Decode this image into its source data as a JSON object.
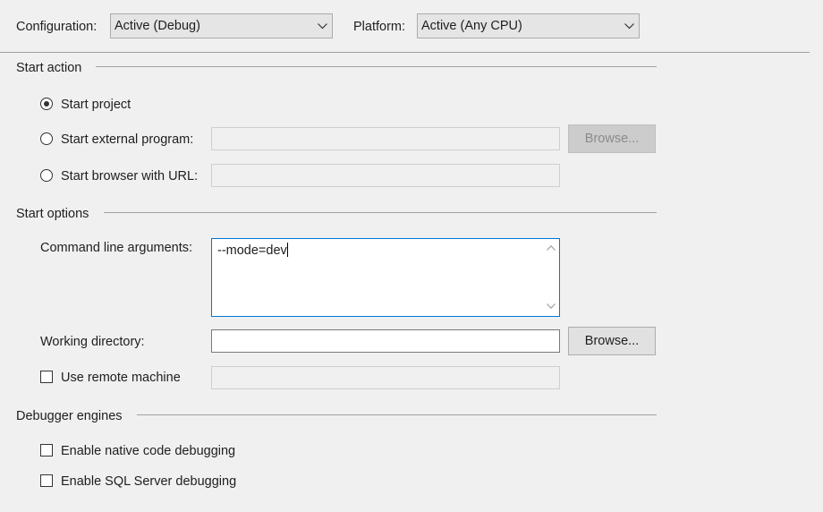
{
  "configuration": {
    "label": "Configuration:",
    "value": "Active (Debug)"
  },
  "platform": {
    "label": "Platform:",
    "value": "Active (Any CPU)"
  },
  "start_action": {
    "heading": "Start action",
    "options": [
      {
        "label": "Start project",
        "selected": true
      },
      {
        "label": "Start external program:",
        "selected": false
      },
      {
        "label": "Start browser with URL:",
        "selected": false
      }
    ],
    "external_program_value": "",
    "url_value": "",
    "browse_label": "Browse..."
  },
  "start_options": {
    "heading": "Start options",
    "cmd_args_label": "Command line arguments:",
    "cmd_args_value": "--mode=dev",
    "working_dir_label": "Working directory:",
    "working_dir_value": "",
    "browse_label": "Browse...",
    "remote_machine_label": "Use remote machine",
    "remote_machine_checked": false,
    "remote_machine_value": ""
  },
  "debugger_engines": {
    "heading": "Debugger engines",
    "native_label": "Enable native code debugging",
    "native_checked": false,
    "sql_label": "Enable SQL Server debugging",
    "sql_checked": false
  },
  "icons": {
    "dropdown": "chevron-down-icon",
    "scroll_up": "scroll-up-arrow-icon",
    "scroll_down": "scroll-down-arrow-icon"
  }
}
